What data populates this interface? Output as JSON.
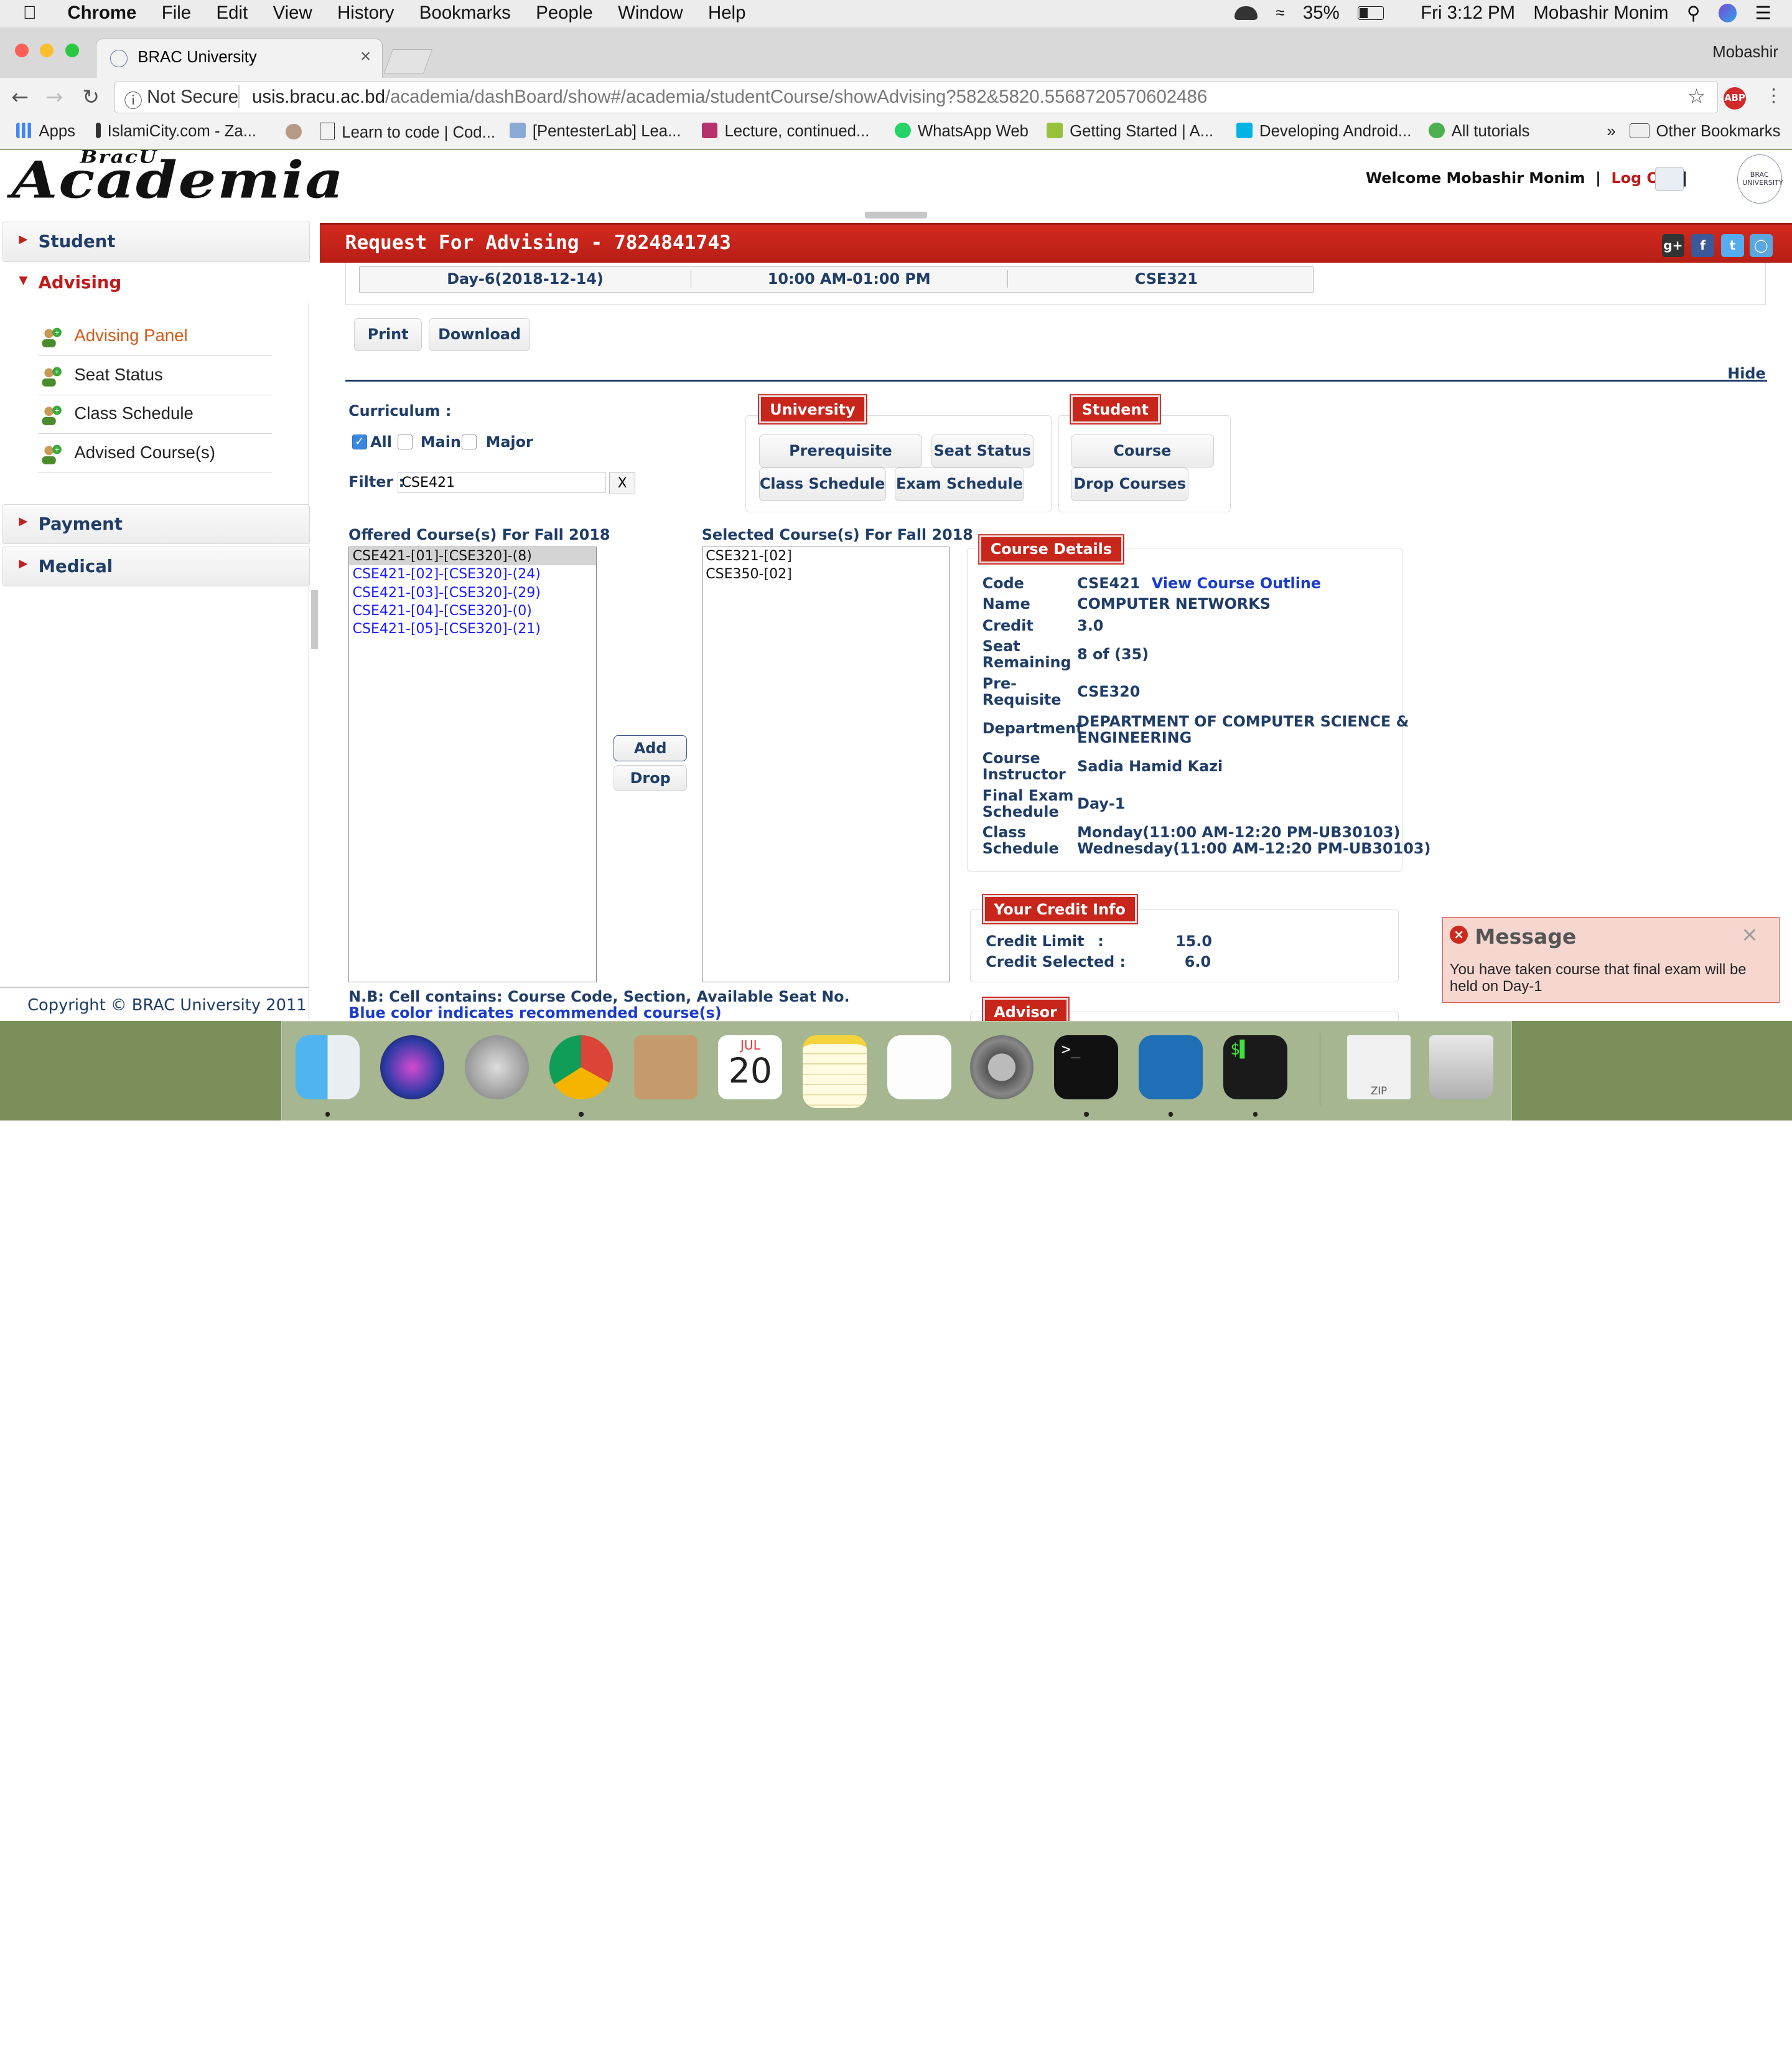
{
  "menubar": {
    "app": "Chrome",
    "items": [
      "File",
      "Edit",
      "View",
      "History",
      "Bookmarks",
      "People",
      "Window",
      "Help"
    ],
    "battery": "35%",
    "clock": "Fri 3:12 PM",
    "user": "Mobashir Monim"
  },
  "browser": {
    "tab_title": "BRAC University",
    "profile": "Mobashir",
    "not_secure": "Not Secure",
    "url_domain": "usis.bracu.ac.bd",
    "url_path": "/academia/dashBoard/show#/academia/studentCourse/showAdvising?582&5820.5568720570602486",
    "abp": "ABP"
  },
  "bookmarks": {
    "items": [
      "Apps",
      "IslamiCity.com - Za...",
      "Learn to code | Cod...",
      "[PentesterLab] Lea...",
      "Lecture, continued...",
      "WhatsApp Web",
      "Getting Started | A...",
      "Developing Android...",
      "All tutorials"
    ],
    "overflow": "»",
    "other": "Other Bookmarks"
  },
  "header": {
    "logo_small": "BracU",
    "logo": "Academia",
    "welcome": "Welcome Mobashir Monim",
    "logout": "Log Out",
    "sep1": "|",
    "sep2": "|",
    "seal": "BRAC UNIVERSITY"
  },
  "sidebar": {
    "student": "Student",
    "advising": "Advising",
    "sub": [
      "Advising Panel",
      "Seat Status",
      "Class Schedule",
      "Advised Course(s)"
    ],
    "payment": "Payment",
    "medical": "Medical",
    "copyright": "Copyright © BRAC University 2011"
  },
  "main": {
    "title": "Request For Advising - 7824841743",
    "exam_row": {
      "day": "Day-6(2018-12-14)",
      "time": "10:00 AM-01:00 PM",
      "course": "CSE321"
    },
    "print": "Print",
    "download": "Download",
    "hide": "Hide",
    "curriculum_label": "Curriculum :",
    "cb_all": "All",
    "cb_main": "Main",
    "cb_major": "Major",
    "filter_label": "Filter :",
    "filter_value": "CSE421",
    "filter_clear": "X",
    "university_tag": "University",
    "uni_buttons": [
      "Prerequisite Courses",
      "Seat Status",
      "Class Schedule",
      "Exam Schedule"
    ],
    "student_tag": "Student",
    "stu_buttons": [
      "Course Sequence",
      "Drop Courses"
    ],
    "offered_label": "Offered Course(s) For Fall 2018",
    "selected_label": "Selected Course(s) For Fall 2018",
    "offered": [
      "CSE421-[01]-[CSE320]-(8)",
      "CSE421-[02]-[CSE320]-(24)",
      "CSE421-[03]-[CSE320]-(29)",
      "CSE421-[04]-[CSE320]-(0)",
      "CSE421-[05]-[CSE320]-(21)"
    ],
    "selected": [
      "CSE321-[02]",
      "CSE350-[02]"
    ],
    "add": "Add",
    "drop": "Drop",
    "note1": "N.B: Cell contains: Course Code, Section, Available Seat No.",
    "note2": "Blue color indicates recommended course(s)"
  },
  "details": {
    "tag": "Course Details",
    "code_k": "Code",
    "code_v": "CSE421",
    "outline": "View Course Outline",
    "name_k": "Name",
    "name_v": "COMPUTER NETWORKS",
    "credit_k": "Credit",
    "credit_v": "3.0",
    "seat_k1": "Seat",
    "seat_k2": "Remaining",
    "seat_v": "8 of (35)",
    "pre_k1": "Pre-",
    "pre_k2": "Requisite",
    "pre_v": "CSE320",
    "dept_k": "Department",
    "dept_v1": "DEPARTMENT OF COMPUTER SCIENCE &",
    "dept_v2": "ENGINEERING",
    "instr_k1": "Course",
    "instr_k2": "Instructor",
    "instr_v": "Sadia Hamid Kazi",
    "final_k1": "Final Exam",
    "final_k2": "Schedule",
    "final_v": "Day-1",
    "class_k1": "Class",
    "class_k2": "Schedule",
    "class_v1": "Monday(11:00 AM-12:20 PM-UB30103)",
    "class_v2": "Wednesday(11:00 AM-12:20 PM-UB30103)"
  },
  "credit": {
    "tag": "Your Credit Info",
    "limit_k": "Credit Limit",
    "colon1": ":",
    "limit_v": "15.0",
    "selected_k": "Credit Selected :",
    "selected_v": "6.0"
  },
  "advisor": {
    "tag": "Advisor"
  },
  "message": {
    "title": "Message",
    "close": "×",
    "body": "You have taken course that final exam will be held on Day-1"
  },
  "dock": {
    "calendar_month": "JUL",
    "calendar_day": "20",
    "zip": "ZIP"
  }
}
